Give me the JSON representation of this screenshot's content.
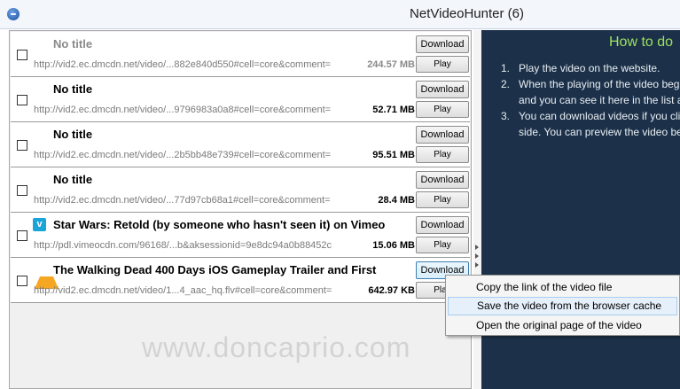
{
  "window": {
    "title": "NetVideoHunter (6)"
  },
  "list": {
    "download_label": "Download",
    "play_label": "Play",
    "rows": [
      {
        "title": "No title",
        "url": "http://vid2.ec.dmcdn.net/video/...882e840d550#cell=core&comment=",
        "size": "244.57 MB",
        "dimmed": true
      },
      {
        "title": "No title",
        "url": "http://vid2.ec.dmcdn.net/video/...9796983a0a8#cell=core&comment=",
        "size": "52.71 MB",
        "dimmed": false
      },
      {
        "title": "No title",
        "url": "http://vid2.ec.dmcdn.net/video/...2b5bb48e739#cell=core&comment=",
        "size": "95.51 MB",
        "dimmed": false
      },
      {
        "title": "No title",
        "url": "http://vid2.ec.dmcdn.net/video/...77d97cb68a1#cell=core&comment=",
        "size": "28.4 MB",
        "dimmed": false
      },
      {
        "title": "Star Wars: Retold (by someone who hasn't seen it) on Vimeo",
        "url": "http://pdl.vimeocdn.com/96168/...b&aksessionid=9e8dc94a0b88452c",
        "size": "15.06 MB",
        "dimmed": false,
        "icon": "vimeo-icon"
      },
      {
        "title": "The Walking Dead 400 Days iOS Gameplay Trailer and First",
        "url": "http://vid2.ec.dmcdn.net/video/1...4_aac_hq.flv#cell=core&comment=",
        "size": "642.97 KB",
        "dimmed": false,
        "icon": "vlc-cone-icon"
      }
    ]
  },
  "help": {
    "title": "How to do",
    "steps": [
      {
        "num": "1.",
        "line1": "Play the video on the website."
      },
      {
        "num": "2.",
        "line1": "When the playing of the video beg",
        "line2": "and you can see it here in the list a"
      },
      {
        "num": "3.",
        "line1": "You can download videos if you cli",
        "line2": "side. You can preview the video be"
      }
    ]
  },
  "context_menu": {
    "items": [
      "Copy the link of the video file",
      "Save the video from the browser cache",
      "Open the original page of the video"
    ],
    "highlighted_index": 1
  },
  "watermark": "www.doncaprio.com",
  "colors": {
    "help_bg": "#1c3149",
    "help_title": "#9be25f",
    "vimeo": "#1aa4d8"
  }
}
